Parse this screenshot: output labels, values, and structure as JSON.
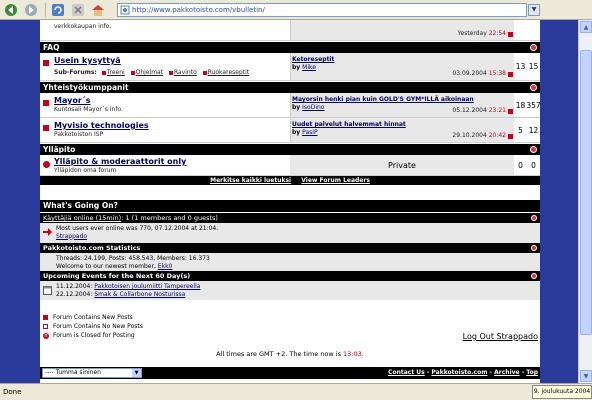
{
  "browser": {
    "address": "http://www.pakkotoisto.com/vbulletin/",
    "status": "Done",
    "clock": "9. joulukuuta 2004"
  },
  "top_partial": {
    "desc": "verkkokaupan info.",
    "date": "Yesterday",
    "time": "22:54"
  },
  "categories": {
    "faq": "FAQ",
    "yhteis": "Yhteistyökumppanit",
    "yllapito": "Ylläpito"
  },
  "forums": {
    "usein": {
      "title": "Usein kysyttyä",
      "subforums_label": "Sub-Forums:",
      "subforums": [
        "Treeni",
        "Ohjelmat",
        "Ravinto",
        "Ruokareseptit"
      ],
      "last_title": "Ketoreseptit",
      "last_by": "by",
      "last_user": "Mike",
      "last_date": "03.09.2004",
      "last_time": "15:38",
      "threads": "13",
      "posts": "15"
    },
    "mayors": {
      "title": "Mayor´s",
      "desc": "Kuntosali Mayor´s info.",
      "last_title": "Mayorsin henki pian kuin GOLD'S GYM*ILLÄ aikoinaan",
      "last_by": "by",
      "last_user": "IsoDino",
      "last_date": "05.12.2004",
      "last_time": "23:21",
      "threads": "18",
      "posts": "357"
    },
    "myvisio": {
      "title": "Myvisio technologies",
      "desc": "Pakkotoiston ISP",
      "last_title": "Uudet palvelut halvemmat hinnat",
      "last_by": "by",
      "last_user": "PasiP",
      "last_date": "29.10.2004",
      "last_time": "20:42",
      "threads": "5",
      "posts": "12"
    },
    "yllapito": {
      "title": "Ylläpito & moderaattorit only",
      "desc": "Ylläpidon oma forum",
      "private": "Private",
      "threads": "0",
      "posts": "0"
    }
  },
  "footer_links": {
    "mark_read": "Merkitse kaikki luetuksi",
    "leaders": "View Forum Leaders"
  },
  "wgo": {
    "title": "What's Going On?",
    "online_link": "Käyttäjiä online (15min)",
    "online_rest": ": 1 (1 members and 0 guests)",
    "most_users": "Most users ever online was 770, 07.12.2004 at 21:04.",
    "online_user": "Strappado",
    "stats_title": "Pakkotoisto.com Statistics",
    "stats_line": "Threads: 24.199, Posts: 458.543, Members: 16.373",
    "welcome": "Welcome to our newest member,",
    "newest": "Ekk0",
    "events_title": "Upcoming Events for the Next 60 Day(s)",
    "event1_date": "11.12.2004:",
    "event1_name": "Pakkotoisen joulumiitti Tampereella",
    "event2_date": "22.12.2004:",
    "event2_name": "Smak & Collarbone Nosturissa"
  },
  "legend": {
    "new": "Forum Contains New Posts",
    "nonew": "Forum Contains No New Posts",
    "closed": "Forum is Closed for Posting"
  },
  "logout": "Log Out Strappado",
  "timezone": {
    "text": "All times are GMT +2. The time now is",
    "time": "13:03",
    "end": "."
  },
  "bottom": {
    "style": "---- Tumma sininen",
    "contact": "Contact Us",
    "sep": " - ",
    "site": "Pakkotoisto.com",
    "archive": "Archive",
    "top": "Top"
  }
}
